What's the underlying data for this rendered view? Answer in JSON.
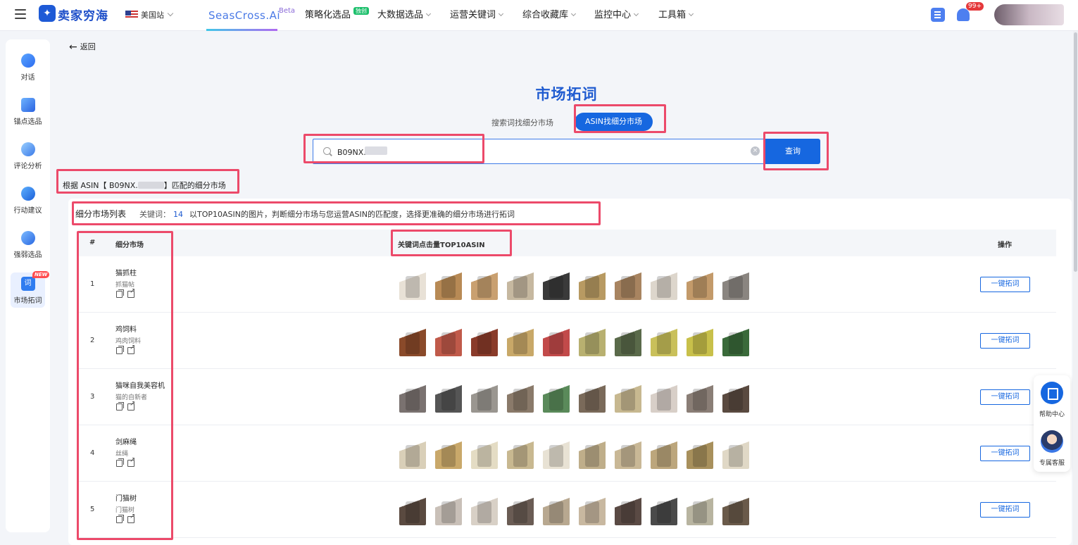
{
  "header": {
    "logo_text": "卖家穷海",
    "site": "美国站",
    "nav": [
      {
        "label": "SeasCross.Ai"
      },
      {
        "label": "策略化选品"
      },
      {
        "label": "大数据选品"
      },
      {
        "label": "运营关键词"
      },
      {
        "label": "综合收藏库"
      },
      {
        "label": "监控中心"
      },
      {
        "label": "工具箱"
      }
    ],
    "beta": "Beta",
    "new_badge": "独创",
    "bell_count": "99+"
  },
  "sidebar": {
    "items": [
      {
        "label": "对话",
        "icon": "chat-icon"
      },
      {
        "label": "锚点选品",
        "icon": "cube-icon"
      },
      {
        "label": "评论分析",
        "icon": "comment-icon"
      },
      {
        "label": "行动建议",
        "icon": "compass-icon"
      },
      {
        "label": "强弱选品",
        "icon": "user-icon"
      },
      {
        "label": "市场拓词",
        "icon": "word-icon",
        "icon_text": "词",
        "tag": "NEW"
      }
    ]
  },
  "page": {
    "back": "返回",
    "title": "市场拓词",
    "mode_keyword": "搜索词找细分市场",
    "mode_asin": "ASIN找细分市场",
    "search_value": "B09NX.",
    "search_button": "查询",
    "match_prefix": "根据 ASIN【 B09NX.",
    "match_suffix": "】匹配的细分市场"
  },
  "list": {
    "heading": "细分市场列表",
    "keyword_label": "关键词：",
    "keyword_count": "14",
    "tip": "以TOP10ASIN的图片，判断细分市场与您运营ASIN的匹配度，选择更准确的细分市场进行拓词",
    "columns": [
      "#",
      "细分市场",
      "关键词点击量TOP10ASIN",
      "操作"
    ],
    "action_label": "一键拓词",
    "rows": [
      {
        "index": "1",
        "name": "猫抓柱",
        "sub": "抓猫帖",
        "colors": [
          "#e8e1d6",
          "#b88a55",
          "#c9a070",
          "#c6b8a0",
          "#3a3a3a",
          "#b89a62",
          "#a88460",
          "#ddd6cc",
          "#c39a6a",
          "#8a8580"
        ]
      },
      {
        "index": "2",
        "name": "鸡饲料",
        "sub": "鸡肉饲料",
        "colors": [
          "#8a4a2a",
          "#c05a4a",
          "#8a3b2a",
          "#c8a868",
          "#c24a4a",
          "#b8b070",
          "#5a6a4a",
          "#c9c05a",
          "#c8c04a",
          "#3a6a3a"
        ]
      },
      {
        "index": "3",
        "name": "猫咪自我美容机",
        "sub": "猫的自新者",
        "colors": [
          "#7a7270",
          "#555555",
          "#9a9690",
          "#8a7a6a",
          "#5a8a5a",
          "#7a6a5a",
          "#c7b890",
          "#d8cfc8",
          "#8a7e76",
          "#5a4a40"
        ]
      },
      {
        "index": "4",
        "name": "剑麻绳",
        "sub": "丝绳",
        "colors": [
          "#d9cfb8",
          "#c9a86a",
          "#e4dcc4",
          "#c8b890",
          "#e8e2d4",
          "#bfae8a",
          "#c9b896",
          "#bca67c",
          "#a8905c",
          "#e0d8c6"
        ]
      },
      {
        "index": "5",
        "name": "门猫树",
        "sub": "门猫树",
        "colors": [
          "#5a4a40",
          "#c9c0b8",
          "#d8d0c6",
          "#6a5c54",
          "#b8a890",
          "#c8b8a0",
          "#5a4a44",
          "#4a4a4a",
          "#b8b4a0",
          "#6a5a4a"
        ]
      }
    ]
  },
  "float": {
    "help": "帮助中心",
    "service": "专属客服"
  }
}
